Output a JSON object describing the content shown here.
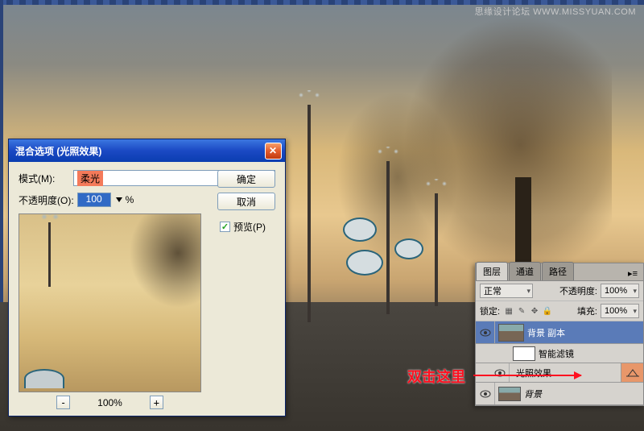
{
  "watermark": "思缘设计论坛   WWW.MISSYUAN.COM",
  "dialog": {
    "title": "混合选项  (光照效果)",
    "mode_label": "模式(M):",
    "mode_value": "柔光",
    "opacity_label": "不透明度(O):",
    "opacity_value": "100",
    "opacity_suffix": "%",
    "ok": "确定",
    "cancel": "取消",
    "preview_label": "预览(P)",
    "zoom_minus": "-",
    "zoom_value": "100%",
    "zoom_plus": "+"
  },
  "layers": {
    "tabs": [
      "图层",
      "通道",
      "路径"
    ],
    "tab_x": "×",
    "blend_mode": "正常",
    "opacity_label": "不透明度:",
    "opacity_value": "100%",
    "lock_label": "锁定:",
    "fill_label": "填充:",
    "fill_value": "100%",
    "items": [
      {
        "name": "背景 副本"
      },
      {
        "name": "智能滤镜"
      },
      {
        "name": "光照效果"
      },
      {
        "name": "背景"
      }
    ]
  },
  "annotation": "双击这里"
}
